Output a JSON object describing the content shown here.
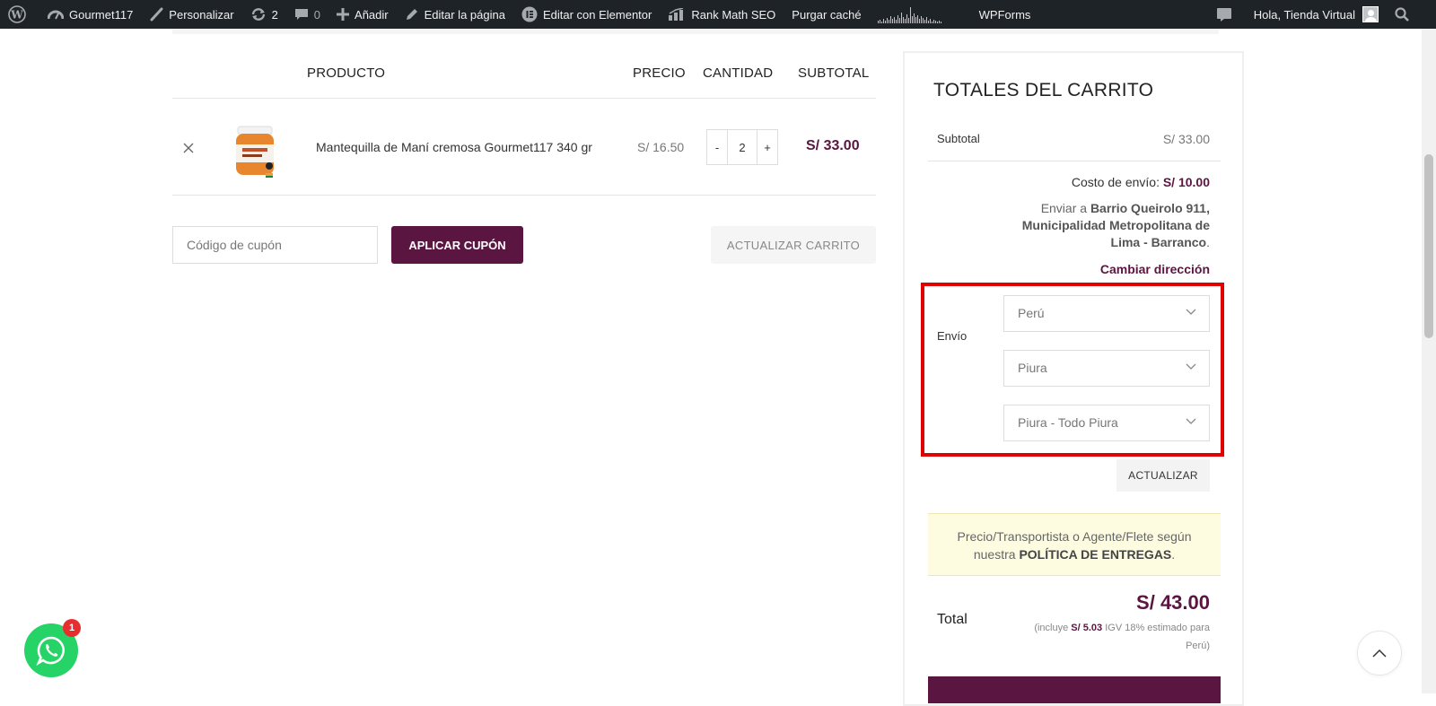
{
  "admin_bar": {
    "site_name": "Gourmet117",
    "customize": "Personalizar",
    "updates_count": "2",
    "comments_count": "0",
    "add_new": "Añadir",
    "edit_page": "Editar la página",
    "edit_elementor": "Editar con Elementor",
    "rank_math": "Rank Math SEO",
    "purge_cache": "Purgar caché",
    "wpforms": "WPForms",
    "greeting": "Hola, Tienda Virtual"
  },
  "cart": {
    "headers": {
      "product": "PRODUCTO",
      "price": "PRECIO",
      "quantity": "CANTIDAD",
      "subtotal": "SUBTOTAL"
    },
    "items": [
      {
        "remove_icon": "close-icon",
        "name": "Mantequilla de Maní cremosa Gourmet117 340 gr",
        "price": "S/ 16.50",
        "quantity": "2",
        "subtotal": "S/ 33.00"
      }
    ],
    "qty_minus": "-",
    "qty_plus": "+",
    "coupon_placeholder": "Código de cupón",
    "apply_coupon": "APLICAR CUPÓN",
    "update_cart": "ACTUALIZAR CARRITO"
  },
  "totals": {
    "title": "TOTALES DEL CARRITO",
    "subtotal_label": "Subtotal",
    "subtotal_value": "S/ 33.00",
    "shipping_cost_label": "Costo de envío:",
    "shipping_cost_value": "S/ 10.00",
    "ship_to_prefix": "Enviar a",
    "ship_to_address": "Barrio Queirolo 911, Municipalidad Metropolitana de Lima - Barranco",
    "ship_to_suffix": ".",
    "change_address": "Cambiar dirección",
    "shipping_label": "Envío",
    "country": "Perú",
    "region": "Piura",
    "district": "Piura - Todo Piura",
    "update_button": "ACTUALIZAR",
    "notice_text": "Precio/Transportista o Agente/Flete según nuestra",
    "notice_bold": "POLÍTICA DE ENTREGAS",
    "notice_end": ".",
    "total_label": "Total",
    "total_value": "S/ 43.00",
    "tax_prefix": "(incluye",
    "tax_amount": "S/ 5.03",
    "tax_suffix": "IGV 18% estimado para Perú)"
  },
  "floating": {
    "whatsapp_badge": "1",
    "whatsapp_icon": "whatsapp-icon",
    "scroll_top_icon": "chevron-up-icon"
  },
  "colors": {
    "brand": "#5a1640",
    "highlight_border": "#e00000",
    "whatsapp": "#25d366"
  }
}
